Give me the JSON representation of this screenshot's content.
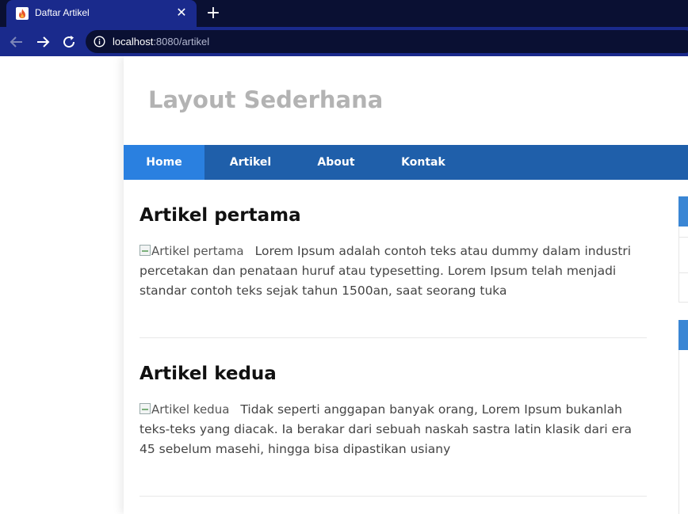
{
  "browser": {
    "tab_title": "Daftar Artikel",
    "close_glyph": "✕",
    "newtab_glyph": "+",
    "url_host": "localhost",
    "url_rest": ":8080/artikel"
  },
  "site": {
    "title": "Layout Sederhana",
    "nav": [
      "Home",
      "Artikel",
      "About",
      "Kontak"
    ],
    "active_nav": "Home",
    "colors": {
      "nav_bg": "#1f5faa",
      "nav_active": "#2a80e0",
      "title": "#b3b3b3",
      "widget": "#3a86d4"
    }
  },
  "articles": [
    {
      "title": "Artikel pertama",
      "img_alt": "Artikel pertama",
      "excerpt": "Lorem Ipsum adalah contoh teks atau dummy dalam industri percetakan dan penataan huruf atau typesetting. Lorem Ipsum telah menjadi standar contoh teks sejak tahun 1500an, saat seorang tuka"
    },
    {
      "title": "Artikel kedua",
      "img_alt": "Artikel kedua",
      "excerpt": "Tidak seperti anggapan banyak orang, Lorem Ipsum bukanlah teks-teks yang diacak. Ia berakar dari sebuah naskah sastra latin klasik dari era 45 sebelum masehi, hingga bisa dipastikan usiany"
    }
  ],
  "icons": {
    "favicon": "flame-favicon-icon",
    "back": "arrow-left-icon",
    "forward": "arrow-right-icon",
    "reload": "reload-icon",
    "info": "info-circle-icon"
  }
}
